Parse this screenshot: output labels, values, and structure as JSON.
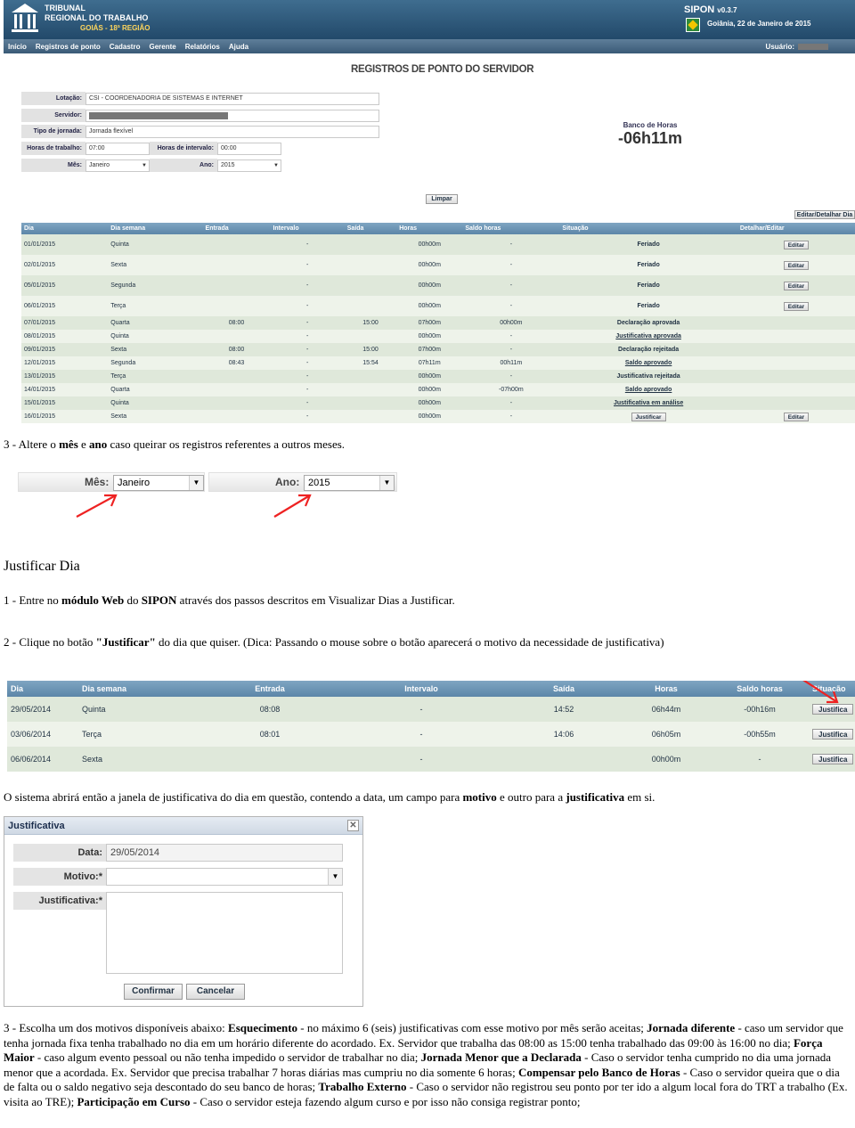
{
  "app": {
    "org_line1": "TRIBUNAL",
    "org_line2": "REGIONAL DO TRABALHO",
    "org_region": "GOIÁS - 18ª REGIÃO",
    "brand": "SIPON",
    "version": "v0.3.7",
    "date": "Goiânia, 22 de Janeiro de 2015",
    "menu": [
      "Início",
      "Registros de ponto",
      "Cadastro",
      "Gerente",
      "Relatórios",
      "Ajuda"
    ],
    "user_label": "Usuário:",
    "page_title": "REGISTROS DE PONTO DO SERVIDOR",
    "form": {
      "lotacao_label": "Lotação:",
      "lotacao_value": "CSI - COORDENADORIA DE SISTEMAS E INTERNET",
      "servidor_label": "Servidor:",
      "tipo_label": "Tipo de jornada:",
      "tipo_value": "Jornada flexível",
      "horas_trab_label": "Horas de trabalho:",
      "horas_trab_value": "07:00",
      "horas_int_label": "Horas de intervalo:",
      "horas_int_value": "00:00",
      "mes_label": "Mês:",
      "mes_value": "Janeiro",
      "ano_label": "Ano:",
      "ano_value": "2015"
    },
    "banco_label": "Banco de Horas",
    "banco_value": "-06h11m",
    "limpar": "Limpar",
    "editar_detalhar": "Editar/Detalhar Dia",
    "table_headers": [
      "Dia",
      "Dia semana",
      "Entrada",
      "Intervalo",
      "Saída",
      "Horas",
      "Saldo horas",
      "Situação",
      "Detalhar/Editar"
    ],
    "rows": [
      {
        "dia": "01/01/2015",
        "semana": "Quinta",
        "entrada": "",
        "intervalo": "-",
        "saida": "",
        "horas": "00h00m",
        "saldo": "-",
        "situacao": "Feriado",
        "acao": "Editar",
        "cls": "st-red",
        "h": "tall"
      },
      {
        "dia": "02/01/2015",
        "semana": "Sexta",
        "entrada": "",
        "intervalo": "-",
        "saida": "",
        "horas": "00h00m",
        "saldo": "-",
        "situacao": "Feriado",
        "acao": "Editar",
        "cls": "st-red",
        "h": "tall"
      },
      {
        "dia": "05/01/2015",
        "semana": "Segunda",
        "entrada": "",
        "intervalo": "-",
        "saida": "",
        "horas": "00h00m",
        "saldo": "-",
        "situacao": "Feriado",
        "acao": "Editar",
        "cls": "st-red",
        "h": "tall"
      },
      {
        "dia": "06/01/2015",
        "semana": "Terça",
        "entrada": "",
        "intervalo": "-",
        "saida": "",
        "horas": "00h00m",
        "saldo": "-",
        "situacao": "Feriado",
        "acao": "Editar",
        "cls": "st-red",
        "h": "tall"
      },
      {
        "dia": "07/01/2015",
        "semana": "Quarta",
        "entrada": "08:00",
        "intervalo": "-",
        "saida": "15:00",
        "horas": "07h00m",
        "saldo": "00h00m",
        "situacao": "Declaração aprovada",
        "acao": "",
        "cls": "st-green",
        "h": "short"
      },
      {
        "dia": "08/01/2015",
        "semana": "Quinta",
        "entrada": "",
        "intervalo": "-",
        "saida": "",
        "horas": "00h00m",
        "saldo": "-",
        "situacao": "Justificativa aprovada",
        "acao": "",
        "cls": "st-green-u",
        "h": "short"
      },
      {
        "dia": "09/01/2015",
        "semana": "Sexta",
        "entrada": "08:00",
        "intervalo": "-",
        "saida": "15:00",
        "horas": "07h00m",
        "saldo": "-",
        "situacao": "Declaração rejeitada",
        "acao": "",
        "cls": "st-red",
        "h": "short"
      },
      {
        "dia": "12/01/2015",
        "semana": "Segunda",
        "entrada": "08:43",
        "intervalo": "-",
        "saida": "15:54",
        "horas": "07h11m",
        "saldo": "00h11m",
        "situacao": "Saldo aprovado",
        "acao": "",
        "cls": "st-green-u",
        "h": "short"
      },
      {
        "dia": "13/01/2015",
        "semana": "Terça",
        "entrada": "",
        "intervalo": "-",
        "saida": "",
        "horas": "00h00m",
        "saldo": "-",
        "situacao": "Justificativa rejeitada",
        "acao": "",
        "cls": "st-red",
        "h": "short"
      },
      {
        "dia": "14/01/2015",
        "semana": "Quarta",
        "entrada": "",
        "intervalo": "-",
        "saida": "",
        "horas": "00h00m",
        "saldo": "-07h00m",
        "situacao": "Saldo aprovado",
        "acao": "",
        "cls": "st-orange-u",
        "h": "short"
      },
      {
        "dia": "15/01/2015",
        "semana": "Quinta",
        "entrada": "",
        "intervalo": "-",
        "saida": "",
        "horas": "00h00m",
        "saldo": "-",
        "situacao": "Justificativa em análise",
        "acao": "",
        "cls": "st-blue-u",
        "h": "short"
      },
      {
        "dia": "16/01/2015",
        "semana": "Sexta",
        "entrada": "",
        "intervalo": "-",
        "saida": "",
        "horas": "00h00m",
        "saldo": "-",
        "situacao": "Justificar",
        "acao": "Editar",
        "cls": "btn",
        "h": "short"
      }
    ]
  },
  "text": {
    "step3_prefix": "3 - Altere o ",
    "step3_mes": "mês",
    "step3_mid": " e ",
    "step3_ano": "ano",
    "step3_suffix": " caso queirar os registros referentes a outros meses.",
    "section_title": "Justificar Dia",
    "step1_prefix": "1 - Entre no ",
    "step1_bold": "módulo Web",
    "step1_mid": " do ",
    "step1_bold2": "SIPON",
    "step1_suffix": " através dos passos descritos em Visualizar Dias a Justificar.",
    "step2_prefix": "2 - Clique no botão ",
    "step2_bold": "\"Justificar\"",
    "step2_suffix": " do dia que quiser. (Dica: Passando o mouse sobre o botão aparecerá o motivo da necessidade de justificativa)",
    "open_prefix": "O sistema abrirá então a janela de justificativa do dia em questão, contendo a data, um campo para ",
    "open_motivo": "motivo",
    "open_mid": " e outro para a ",
    "open_just": "justificativa",
    "open_suffix": " em si.",
    "final": {
      "p1": "3 - Escolha um dos motivos disponíveis abaixo: ",
      "b1": "Esquecimento",
      "p2": " - no máximo 6 (seis) justificativas com esse motivo por mês serão aceitas; ",
      "b2": "Jornada diferente",
      "p3": " - caso um servidor que tenha jornada fixa tenha trabalhado no dia em um horário diferente do acordado. Ex. Servidor que trabalha das 08:00 as 15:00 tenha trabalhado das 09:00 às 16:00 no dia; ",
      "b3": "Força Maior",
      "p4": " - caso algum evento pessoal ou não tenha impedido o servidor de trabalhar no dia; ",
      "b4": "Jornada Menor que a Declarada",
      "p5": " - Caso o servidor tenha cumprido no dia uma jornada menor que a acordada. Ex. Servidor que precisa trabalhar 7 horas diárias mas cumpriu no dia somente 6 horas; ",
      "b5": "Compensar pelo Banco de Horas",
      "p6": " - Caso o servidor queira que o dia de falta ou o saldo negativo seja descontado do seu banco de horas; ",
      "b6": "Trabalho Externo",
      "p7": " - Caso o servidor não registrou seu ponto por ter ido a algum local fora do TRT a trabalho (Ex. visita ao TRE); ",
      "b7": "Participação em Curso",
      "p8": " - Caso o servidor esteja fazendo algum curso e por isso não consiga registrar ponto;"
    }
  },
  "mes_ano": {
    "mes_label": "Mês:",
    "mes_value": "Janeiro",
    "ano_label": "Ano:",
    "ano_value": "2015"
  },
  "just_table": {
    "headers": [
      "Dia",
      "Dia semana",
      "Entrada",
      "Intervalo",
      "Saída",
      "Horas",
      "Saldo horas",
      "Situação"
    ],
    "rows": [
      {
        "dia": "29/05/2014",
        "semana": "Quinta",
        "entrada": "08:08",
        "intervalo": "-",
        "saida": "14:52",
        "horas": "06h44m",
        "saldo": "-00h16m",
        "acao": "Justifica"
      },
      {
        "dia": "03/06/2014",
        "semana": "Terça",
        "entrada": "08:01",
        "intervalo": "-",
        "saida": "14:06",
        "horas": "06h05m",
        "saldo": "-00h55m",
        "acao": "Justifica"
      },
      {
        "dia": "06/06/2014",
        "semana": "Sexta",
        "entrada": "",
        "intervalo": "-",
        "saida": "",
        "horas": "00h00m",
        "saldo": "-",
        "acao": "Justifica"
      }
    ]
  },
  "dialog": {
    "title": "Justificativa",
    "close": "✕",
    "data_label": "Data:",
    "data_value": "29/05/2014",
    "motivo_label": "Motivo:*",
    "just_label": "Justificativa:*",
    "confirm": "Confirmar",
    "cancel": "Cancelar"
  }
}
